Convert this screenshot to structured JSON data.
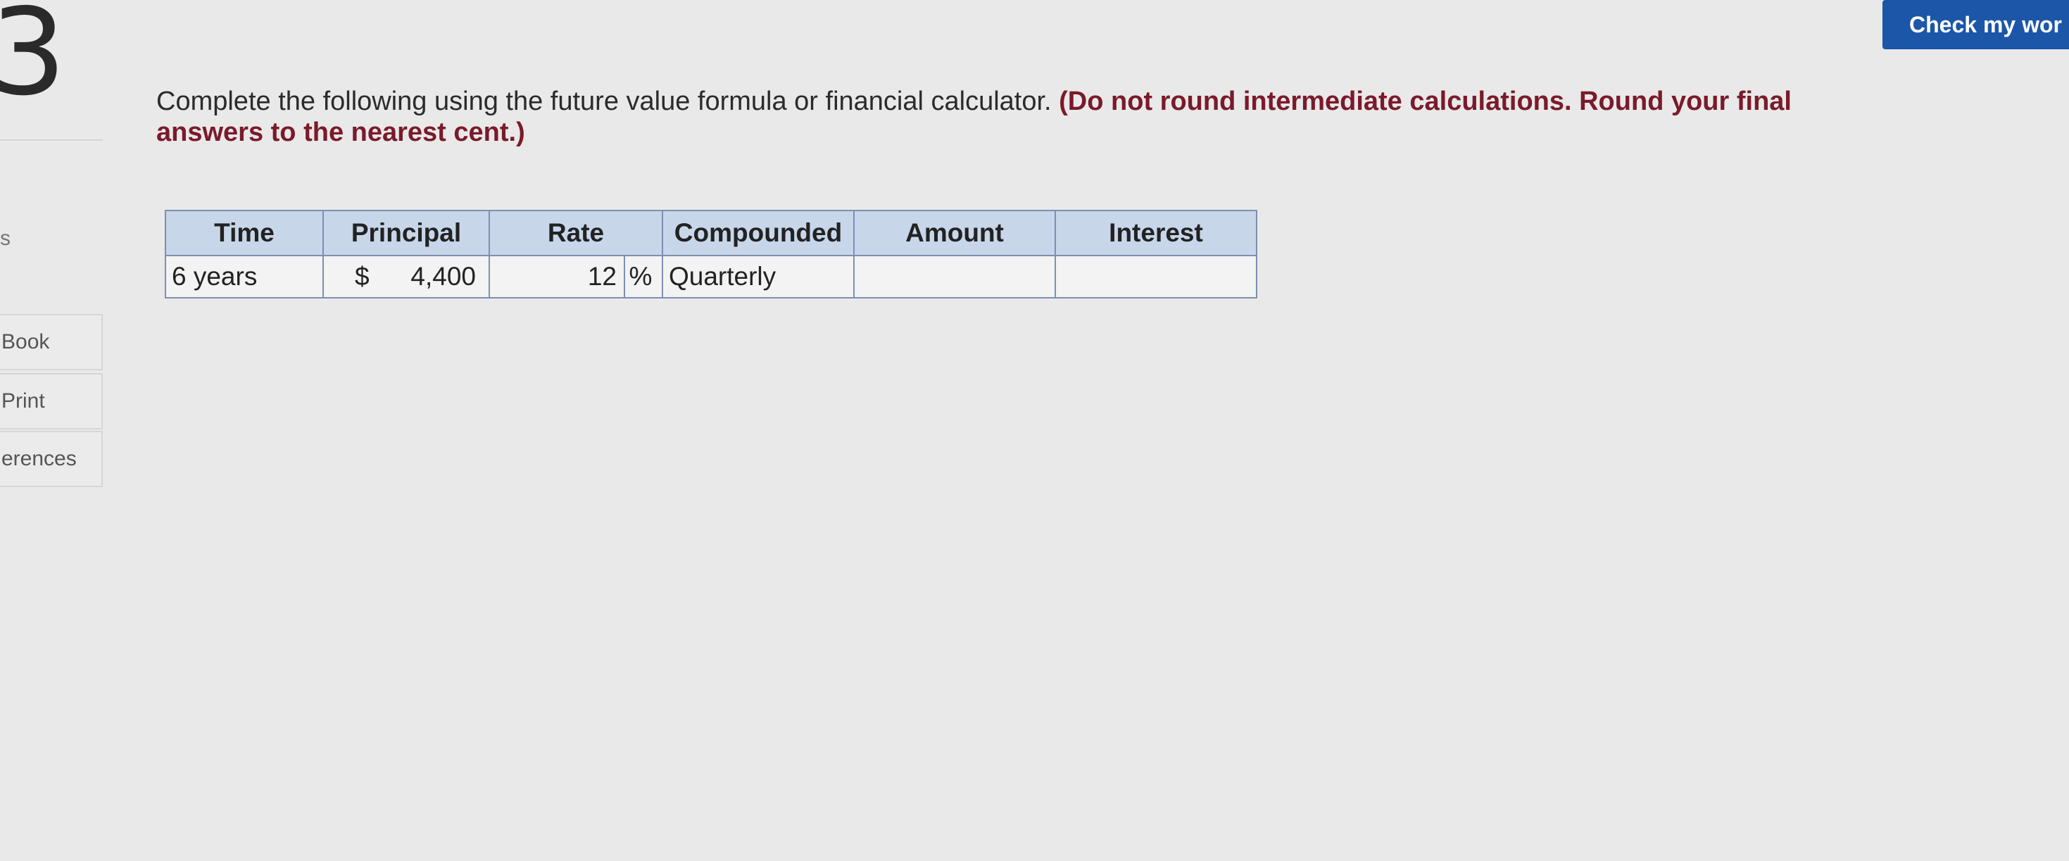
{
  "sidebar": {
    "question_number": "3",
    "points_fragment": "s",
    "links": [
      {
        "label": "Book"
      },
      {
        "label": "Print"
      },
      {
        "label": "erences"
      }
    ]
  },
  "header": {
    "check_button_label": "Check my wor"
  },
  "question": {
    "text": "Complete the following using the future value formula or financial calculator.",
    "emphasis": "(Do not round intermediate calculations. Round your final answers to the nearest cent.)"
  },
  "table": {
    "headers": {
      "time": "Time",
      "principal": "Principal",
      "rate": "Rate",
      "compounded": "Compounded",
      "amount": "Amount",
      "interest": "Interest"
    },
    "row": {
      "time": "6 years",
      "principal_symbol": "$",
      "principal": "4,400",
      "rate": "12",
      "rate_unit": "%",
      "compounded": "Quarterly",
      "amount": "",
      "interest": ""
    }
  },
  "colors": {
    "accent": "#1b56a8",
    "header_bg": "#c8d6ea",
    "emphasis": "#7a1a2a"
  }
}
